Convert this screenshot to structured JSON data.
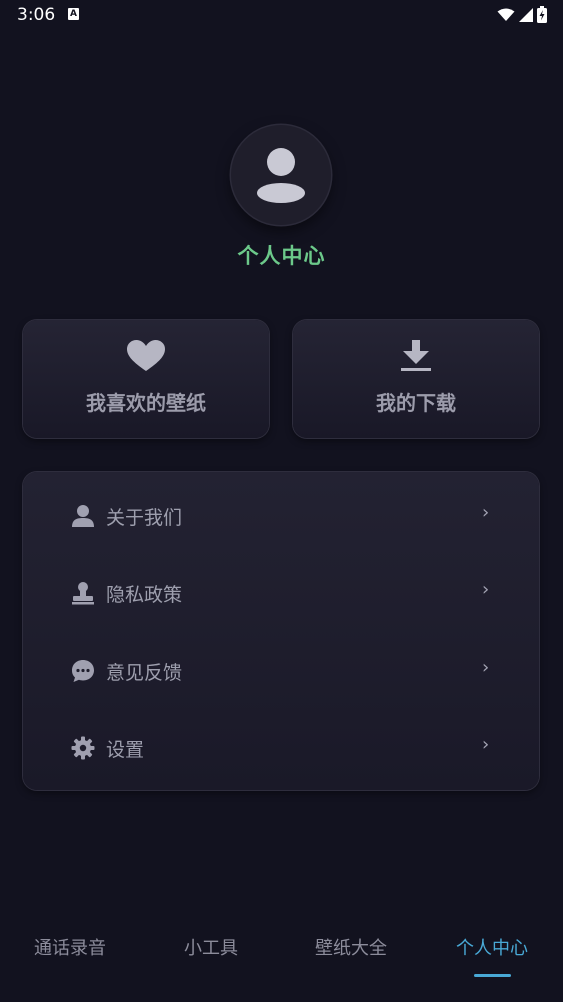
{
  "status_bar": {
    "time": "3:06",
    "notification_icon": "A",
    "icons": [
      "wifi-icon",
      "signal-icon",
      "battery-charging-icon"
    ]
  },
  "profile": {
    "avatar_icon": "user-avatar-icon",
    "title": "个人中心",
    "title_color": "#6cc98a"
  },
  "cards": {
    "favorites": {
      "label": "我喜欢的壁纸",
      "icon": "heart-icon"
    },
    "downloads": {
      "label": "我的下载",
      "icon": "download-icon"
    }
  },
  "menu": {
    "items": [
      {
        "label": "关于我们",
        "icon": "user-icon",
        "chevron": "›"
      },
      {
        "label": "隐私政策",
        "icon": "stamp-icon",
        "chevron": "›"
      },
      {
        "label": "意见反馈",
        "icon": "chat-bubble-icon",
        "chevron": "›"
      },
      {
        "label": "设置",
        "icon": "gear-icon",
        "chevron": "›"
      }
    ]
  },
  "bottom_nav": {
    "tabs": [
      {
        "label": "通话录音",
        "active": false
      },
      {
        "label": "小工具",
        "active": false
      },
      {
        "label": "壁纸大全",
        "active": false
      },
      {
        "label": "个人中心",
        "active": true
      }
    ],
    "active_color": "#49a9d6"
  }
}
